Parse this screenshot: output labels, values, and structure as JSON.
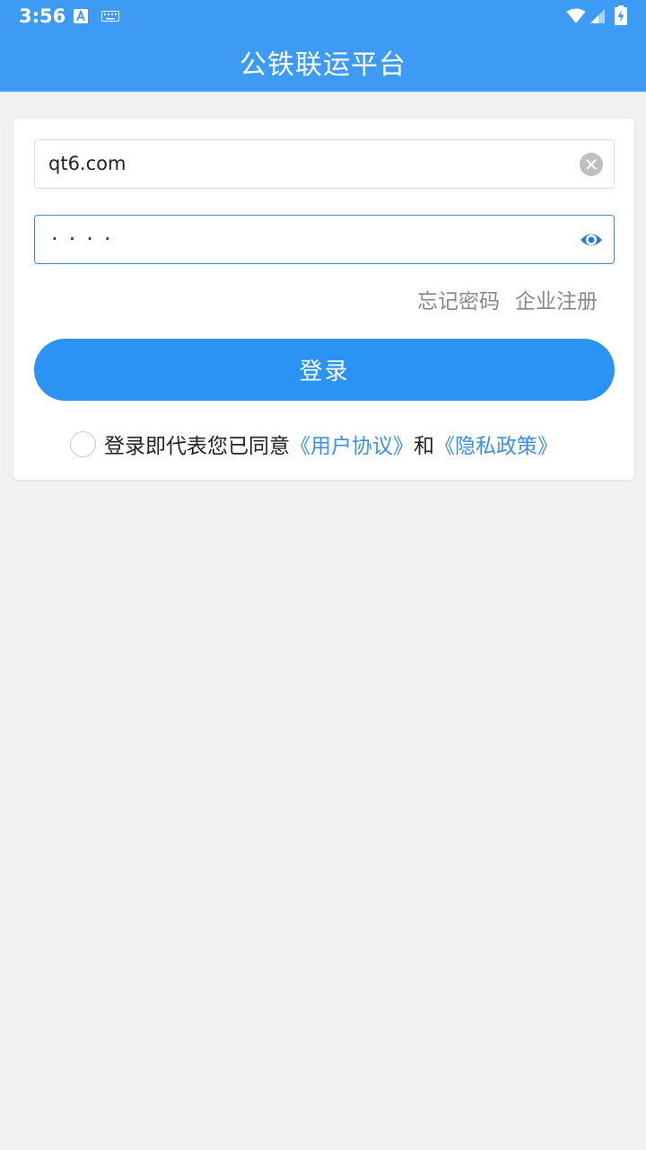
{
  "status_bar": {
    "time": "3:56",
    "icons": [
      "a-badge-icon",
      "keyboard-icon",
      "wifi-icon",
      "signal-icon",
      "battery-charging-icon"
    ]
  },
  "header": {
    "title": "公铁联运平台"
  },
  "login_form": {
    "username_value": "qt6.com",
    "password_masked": "····",
    "forgot_password": "忘记密码",
    "company_register": "企业注册",
    "login_button": "登录"
  },
  "agreement": {
    "prefix": "登录即代表您已同意",
    "user_agreement": "《用户协议》",
    "and": "和",
    "privacy_policy": "《隐私政策》"
  },
  "colors": {
    "primary": "#3d9bf5",
    "button": "#2b93f4",
    "link": "#3d8fe6",
    "background": "#f1f1f1"
  }
}
